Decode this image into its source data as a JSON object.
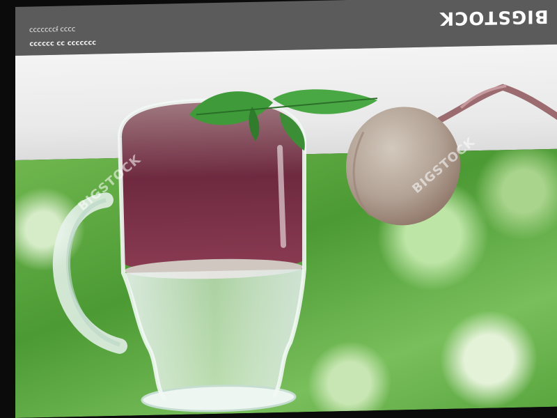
{
  "watermark": {
    "brand": "BIGSTOCK",
    "caption_line1": "ɔɔɔɔ ɟɔɔɔɔɔɔɔ",
    "caption_line2": "ɔɔɔɔɔɔɔ ɔɔ ɔɔɔɔɔɔ",
    "stamp": "BIGSTOCK"
  },
  "colors": {
    "banner": "#5b5b5b",
    "shelf": "#f0f0f0",
    "garden": "#5fae43",
    "beet_juice": "#7a2f45",
    "beet": "#b6a99b",
    "leaf": "#3f9a3a"
  }
}
